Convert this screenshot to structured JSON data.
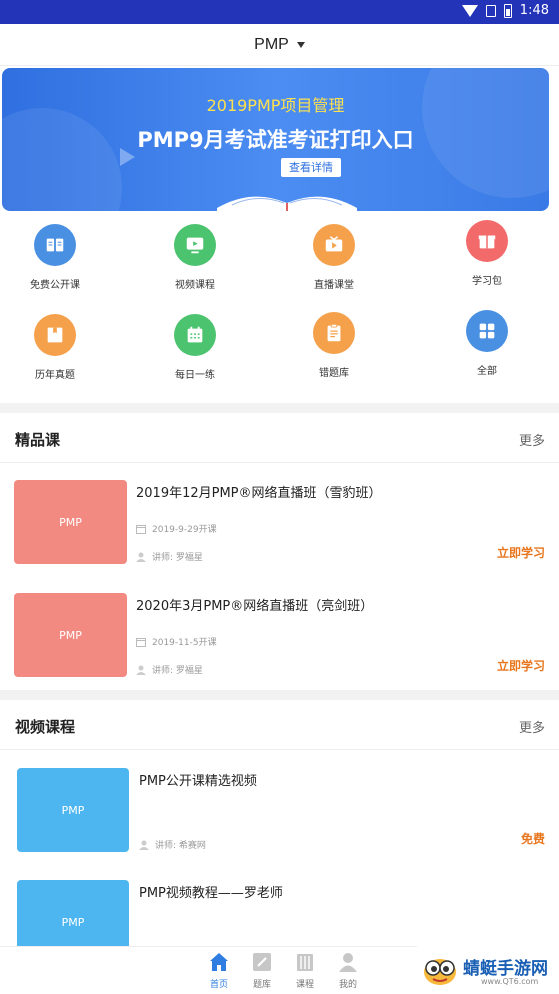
{
  "status_bar": {
    "time": "1:48"
  },
  "header": {
    "title": "PMP"
  },
  "banner": {
    "subtitle": "2019PMP项目管理",
    "title": "PMP9月考试准考证打印入口",
    "button_label": "查看详情"
  },
  "grid": [
    {
      "label": "免费公开课",
      "icon": "book-icon",
      "color": "#4a90e2"
    },
    {
      "label": "视频课程",
      "icon": "video-icon",
      "color": "#4cc36e"
    },
    {
      "label": "直播课堂",
      "icon": "tv-icon",
      "color": "#f5a04a"
    },
    {
      "label": "学习包",
      "icon": "gift-icon",
      "color": "#f26a6a"
    },
    {
      "label": "历年真题",
      "icon": "box-icon",
      "color": "#f5a04a"
    },
    {
      "label": "每日一练",
      "icon": "calendar-icon",
      "color": "#4cc36e"
    },
    {
      "label": "错题库",
      "icon": "clipboard-icon",
      "color": "#f5a04a"
    },
    {
      "label": "全部",
      "icon": "apps-icon",
      "color": "#4a90e2"
    }
  ],
  "premium": {
    "title": "精品课",
    "more": "更多",
    "items": [
      {
        "thumb": "PMP",
        "title": "2019年12月PMP®网络直播班（雪豹班）",
        "date": "2019-9-29开课",
        "teacher": "讲师: 罗福星",
        "action": "立即学习"
      },
      {
        "thumb": "PMP",
        "title": "2020年3月PMP®网络直播班（亮剑班）",
        "date": "2019-11-5开课",
        "teacher": "讲师: 罗福星",
        "action": "立即学习"
      }
    ]
  },
  "videos": {
    "title": "视频课程",
    "more": "更多",
    "items": [
      {
        "thumb": "PMP",
        "title": "PMP公开课精选视频",
        "teacher": "讲师: 希赛网",
        "action": "免费"
      },
      {
        "thumb": "PMP",
        "title": "PMP视频教程——罗老师"
      }
    ]
  },
  "nav": [
    {
      "label": "首页",
      "icon": "home-icon"
    },
    {
      "label": "题库",
      "icon": "edit-icon"
    },
    {
      "label": "课程",
      "icon": "library-icon"
    },
    {
      "label": "我的",
      "icon": "user-icon"
    }
  ],
  "watermark": {
    "text": "蜻蜓手游网",
    "url": "www.QT6.com"
  },
  "colors": {
    "accent": "#2f7de0",
    "action": "#e8761e",
    "premium_thumb": "#f28a82",
    "video_thumb": "#4db6f0",
    "status_bar": "#2334b8"
  }
}
